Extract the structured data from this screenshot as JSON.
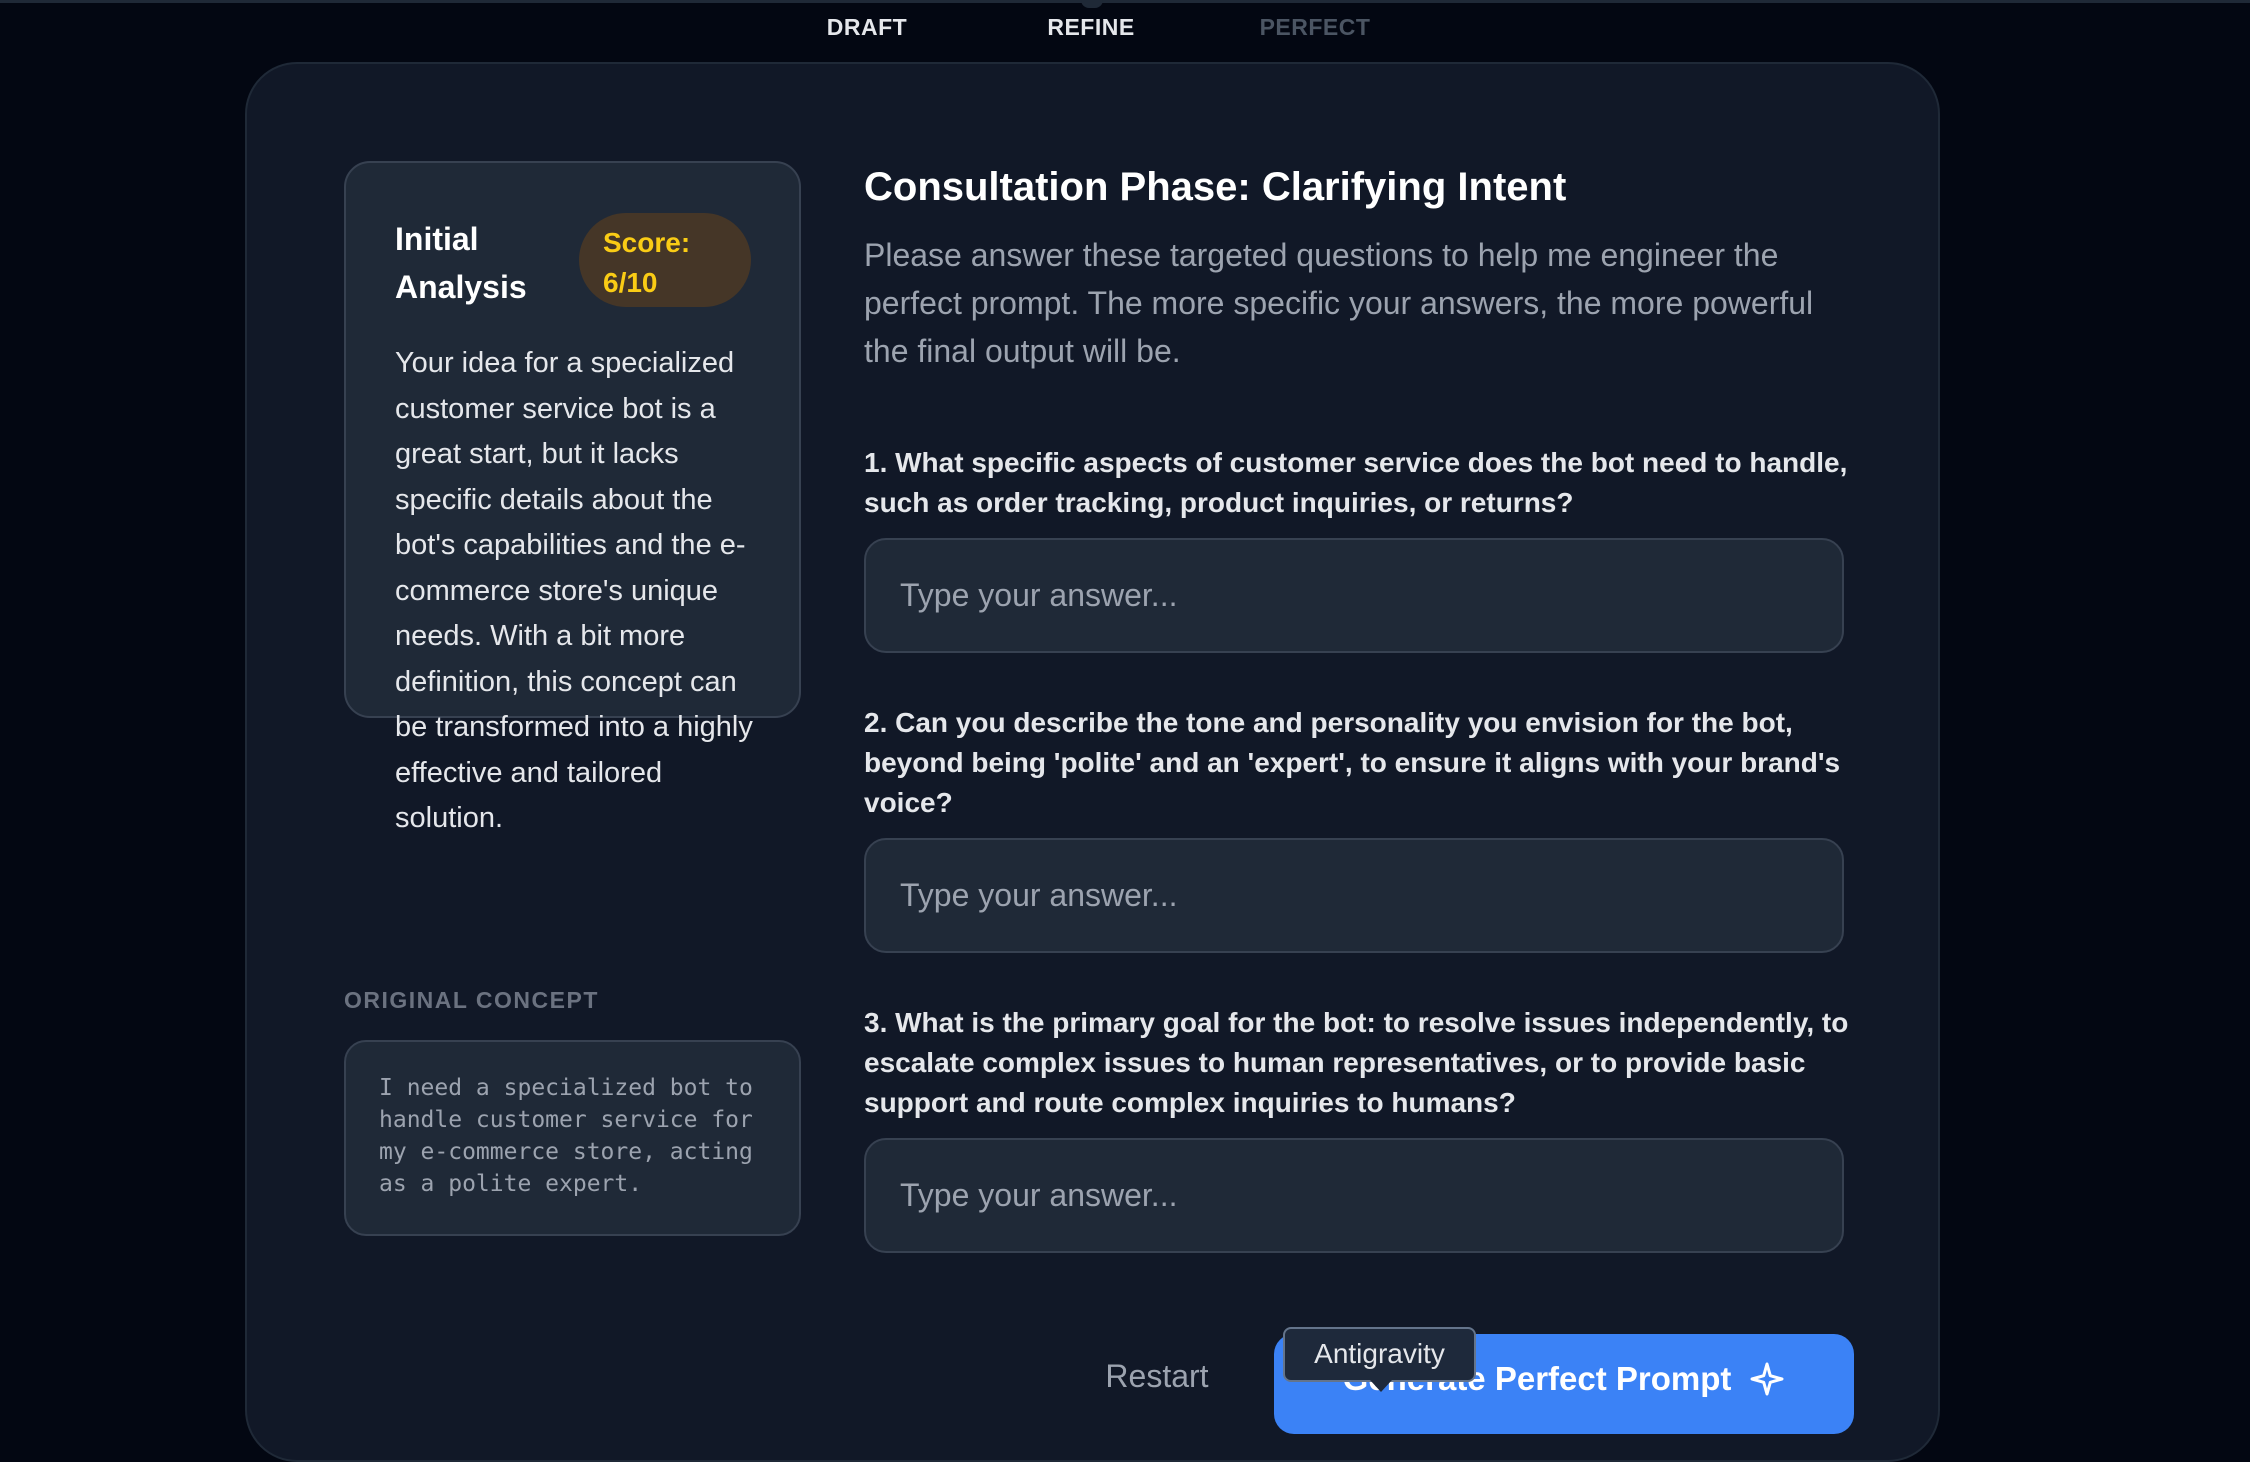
{
  "steps": [
    {
      "label": "DRAFT"
    },
    {
      "label": "REFINE"
    },
    {
      "label": "PERFECT"
    }
  ],
  "analysis": {
    "title": "Initial Analysis",
    "score": "Score: 6/10",
    "text": "Your idea for a specialized customer service bot is a great start, but it lacks specific details about the bot's capabilities and the e-commerce store's unique needs. With a bit more definition, this concept can be transformed into a highly effective and tailored solution."
  },
  "original": {
    "heading": "ORIGINAL CONCEPT",
    "text": "I need a specialized bot to handle customer service for my e-commerce store, acting as a polite expert."
  },
  "consultation": {
    "title": "Consultation Phase: Clarifying Intent",
    "subtitle": "Please answer these targeted questions to help me engineer the perfect prompt. The more specific your answers, the more powerful the final output will be.",
    "questions": [
      {
        "label": "1. What specific aspects of customer service does the bot need to handle, such as order tracking, product inquiries, or returns?",
        "placeholder": "Type your answer...",
        "value": ""
      },
      {
        "label": "2. Can you describe the tone and personality you envision for the bot, beyond being 'polite' and an 'expert', to ensure it aligns with your brand's voice?",
        "placeholder": "Type your answer...",
        "value": ""
      },
      {
        "label": "3. What is the primary goal for the bot: to resolve issues independently, to escalate complex issues to human representatives, or to provide basic support and route complex inquiries to humans?",
        "placeholder": "Type your answer...",
        "value": ""
      }
    ]
  },
  "actions": {
    "restart": "Restart",
    "generate": "Generate Perfect Prompt",
    "generate_icon": "sparkle-icon"
  },
  "tooltip": {
    "text": "Antigravity"
  },
  "colors": {
    "background": "#030712",
    "card": "#111827",
    "panel": "#1f2937",
    "accent": "#3b82f6",
    "score": "#facc15"
  }
}
